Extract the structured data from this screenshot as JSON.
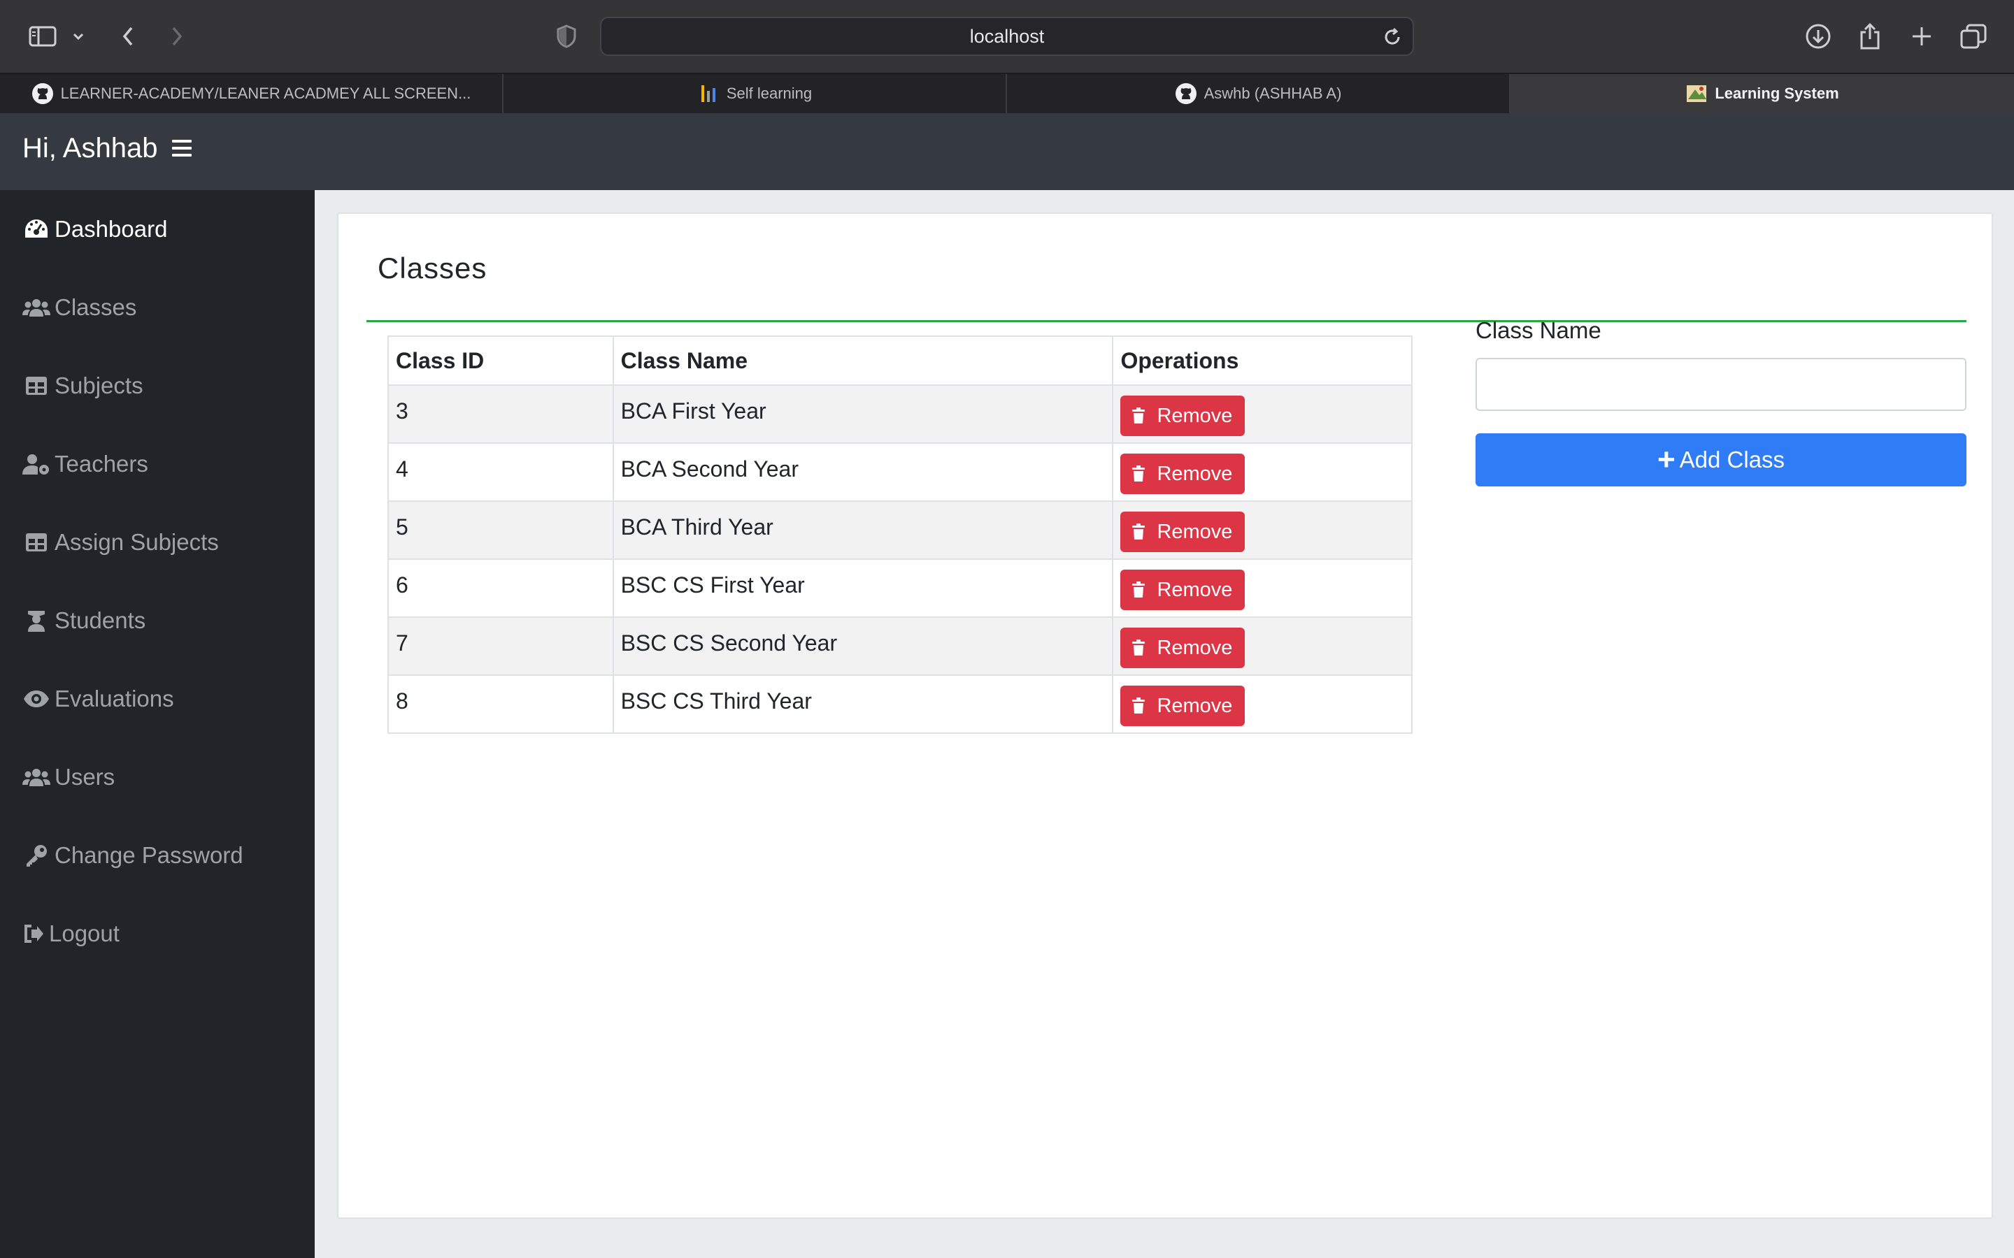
{
  "browser": {
    "address": "localhost",
    "tabs": [
      {
        "label": "LEARNER-ACADEMY/LEANER ACADMEY ALL SCREEN...",
        "icon": "github-icon",
        "active": false
      },
      {
        "label": "Self learning",
        "icon": "bar-chart-icon",
        "active": false
      },
      {
        "label": "Aswhb (ASHHAB A)",
        "icon": "github-icon",
        "active": false
      },
      {
        "label": "Learning System",
        "icon": "app-favicon-icon",
        "active": true
      }
    ]
  },
  "navbar": {
    "greeting": "Hi, Ashhab",
    "menu_icon": "hamburger-icon"
  },
  "sidebar": {
    "items": [
      {
        "label": "Dashboard",
        "icon": "dashboard-icon",
        "active": true
      },
      {
        "label": "Classes",
        "icon": "users-icon",
        "active": false
      },
      {
        "label": "Subjects",
        "icon": "table-icon",
        "active": false
      },
      {
        "label": "Teachers",
        "icon": "user-cog-icon",
        "active": false
      },
      {
        "label": "Assign Subjects",
        "icon": "table-icon",
        "active": false
      },
      {
        "label": "Students",
        "icon": "graduate-icon",
        "active": false
      },
      {
        "label": "Evaluations",
        "icon": "eye-icon",
        "active": false
      },
      {
        "label": "Users",
        "icon": "users-icon",
        "active": false
      },
      {
        "label": "Change Password",
        "icon": "key-icon",
        "active": false
      },
      {
        "label": "Logout",
        "icon": "logout-icon",
        "active": false
      }
    ]
  },
  "main": {
    "title": "Classes",
    "table": {
      "headers": [
        "Class ID",
        "Class Name",
        "Operations"
      ],
      "remove_label": "Remove",
      "rows": [
        {
          "id": "3",
          "name": "BCA First Year"
        },
        {
          "id": "4",
          "name": "BCA Second Year"
        },
        {
          "id": "5",
          "name": "BCA Third Year"
        },
        {
          "id": "6",
          "name": "BSC CS First Year"
        },
        {
          "id": "7",
          "name": "BSC CS Second Year"
        },
        {
          "id": "8",
          "name": "BSC CS Third Year"
        }
      ]
    },
    "form": {
      "label": "Class Name",
      "value": "",
      "placeholder": "",
      "submit_label": "Add Class"
    }
  },
  "colors": {
    "navbar": "#343a40",
    "sidebar": "#212529",
    "accent_rule": "#28a745",
    "danger": "#dc3545",
    "primary": "#2f7cf6"
  }
}
